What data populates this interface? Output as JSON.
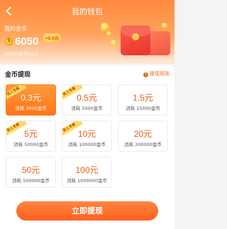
{
  "header": {
    "title": "我的钱包",
    "my_coins_label": "我的金币",
    "coin_amount": "6050",
    "approx_badge": "≈0.6元",
    "rate_text": "10000金币=1元"
  },
  "withdraw": {
    "section_title": "金币提现",
    "rules_label": "提现规则",
    "options": [
      {
        "amount": "0.3元",
        "cost": "消耗 3000金币",
        "ribbon": "新人专属",
        "selected": true
      },
      {
        "amount": "0.5元",
        "cost": "消耗 5000金币",
        "ribbon": "新人专属",
        "selected": false
      },
      {
        "amount": "1.5元",
        "cost": "消耗 15000金币",
        "ribbon": "",
        "selected": false
      },
      {
        "amount": "5元",
        "cost": "消耗 50000金币",
        "ribbon": "新人专属",
        "selected": false
      },
      {
        "amount": "10元",
        "cost": "消耗 100000金币",
        "ribbon": "新人专属",
        "selected": false
      },
      {
        "amount": "20元",
        "cost": "消耗 200000金币",
        "ribbon": "",
        "selected": false
      },
      {
        "amount": "50元",
        "cost": "消耗 500000金币",
        "ribbon": "",
        "selected": false
      },
      {
        "amount": "100元",
        "cost": "消耗 1000000金币",
        "ribbon": "",
        "selected": false
      }
    ]
  },
  "action": {
    "withdraw_button": "立即提现"
  },
  "colors": {
    "accent": "#ff7418",
    "header_start": "#ff8a3d",
    "ribbon": "#ffd75a"
  },
  "icons": [
    "back-arrow-icon",
    "coin-icon",
    "info-icon",
    "red-envelope-icon"
  ]
}
